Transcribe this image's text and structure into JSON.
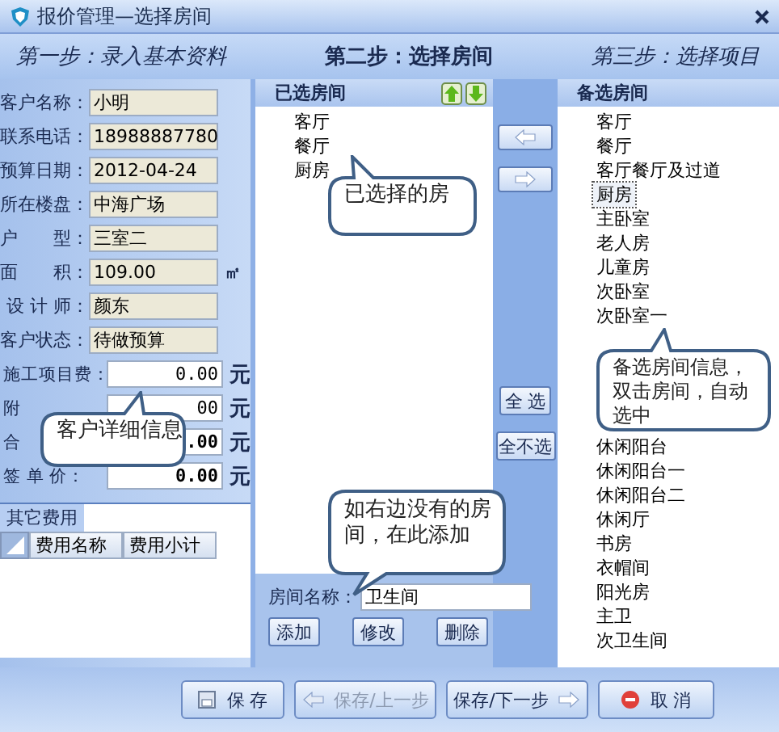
{
  "window": {
    "title": "报价管理—选择房间"
  },
  "steps": [
    {
      "label": "第一步：录入基本资料",
      "selected": false
    },
    {
      "label": "第二步：选择房间",
      "selected": true
    },
    {
      "label": "第三步：选择项目",
      "selected": false
    }
  ],
  "customer": {
    "fields": [
      {
        "label": "客户名称：",
        "value": "小明"
      },
      {
        "label": "联系电话：",
        "value": "18988887780"
      },
      {
        "label": "预算日期：",
        "value": "2012-04-24"
      },
      {
        "label": "所在楼盘：",
        "value": "中海广场"
      },
      {
        "label": "户　　型：",
        "value": "三室二"
      },
      {
        "label": "面　　积：",
        "value": "109.00",
        "unit": "㎡"
      },
      {
        "label": "设 计 师：",
        "value": "颜东"
      },
      {
        "label": "客户状态：",
        "value": "待做预算"
      }
    ],
    "amounts": [
      {
        "label": "施工项目费：",
        "value": "0.00",
        "unit": "元",
        "bold": false
      },
      {
        "label": "附",
        "value": "00",
        "unit": "元",
        "bold": false
      },
      {
        "label": "合",
        "value": ".00",
        "unit": "元",
        "bold": true
      },
      {
        "label": "签 单 价：",
        "value": "0.00",
        "unit": "元",
        "bold": true
      }
    ],
    "callout": "客户详细信息"
  },
  "other_fees": {
    "title": "其它费用",
    "columns": [
      "费用名称",
      "费用小计"
    ]
  },
  "selected_rooms": {
    "title": "已选房间",
    "items": [
      "客厅",
      "餐厅",
      "厨房"
    ],
    "callout": "已选择的房"
  },
  "add_room": {
    "label": "房间名称：",
    "value": "卫生间",
    "buttons": [
      "添加",
      "修改",
      "删除"
    ],
    "callout": "如右边没有的房间，在此添加"
  },
  "transfer_buttons": [
    "全 选",
    "全不选"
  ],
  "candidate_rooms": {
    "title": "备选房间",
    "items_above": [
      {
        "label": "客厅",
        "selected": false
      },
      {
        "label": "餐厅",
        "selected": false
      },
      {
        "label": "客厅餐厅及过道",
        "selected": false
      },
      {
        "label": "厨房",
        "selected": true
      },
      {
        "label": "主卧室",
        "selected": false
      },
      {
        "label": "老人房",
        "selected": false
      },
      {
        "label": "儿童房",
        "selected": false
      },
      {
        "label": "次卧室",
        "selected": false
      },
      {
        "label": "次卧室一",
        "selected": false
      }
    ],
    "items_below": [
      {
        "label": "休闲阳台",
        "selected": false
      },
      {
        "label": "休闲阳台一",
        "selected": false
      },
      {
        "label": "休闲阳台二",
        "selected": false
      },
      {
        "label": "休闲厅",
        "selected": false
      },
      {
        "label": "书房",
        "selected": false
      },
      {
        "label": "衣帽间",
        "selected": false
      },
      {
        "label": "阳光房",
        "selected": false
      },
      {
        "label": "主卫",
        "selected": false
      },
      {
        "label": "次卫生间",
        "selected": false
      }
    ],
    "callout": "备选房间信息，双击房间，自动选中"
  },
  "footer_buttons": [
    {
      "label": "保 存",
      "kind": "save",
      "disabled": false
    },
    {
      "label": "保存/上一步",
      "kind": "prev",
      "disabled": true
    },
    {
      "label": "保存/下一步",
      "kind": "next",
      "disabled": false
    },
    {
      "label": "取 消",
      "kind": "cancel",
      "disabled": false
    }
  ]
}
